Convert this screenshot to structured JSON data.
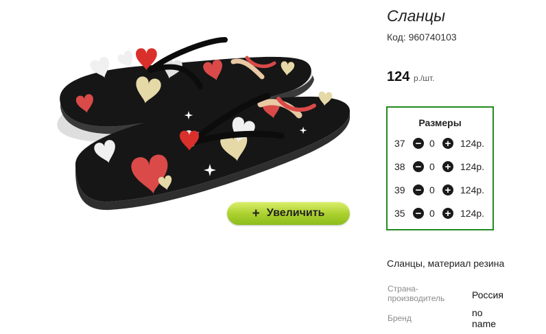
{
  "product": {
    "title": "Сланцы",
    "code_label": "Код:",
    "code_value": "960740103",
    "price_amount": "124",
    "price_unit": "р./шт.",
    "zoom_icon": "+",
    "zoom_label": "Увеличить",
    "image_icon": "flip-flops-product-photo",
    "description": "Сланцы, материал резина"
  },
  "sizes": {
    "title": "Размеры",
    "minus_icon": "−",
    "plus_icon": "+",
    "rows": [
      {
        "size": "37",
        "qty": "0",
        "price": "124р."
      },
      {
        "size": "38",
        "qty": "0",
        "price": "124р."
      },
      {
        "size": "39",
        "qty": "0",
        "price": "124р."
      },
      {
        "size": "35",
        "qty": "0",
        "price": "124р."
      }
    ]
  },
  "specs": [
    {
      "label_line1": "Страна-",
      "label_line2": "производитель",
      "value_line1": "Россия",
      "value_line2": ""
    },
    {
      "label_line1": "Бренд",
      "label_line2": "",
      "value_line1": "no",
      "value_line2": "name"
    }
  ],
  "colors": {
    "accent_border": "#1f8a1f",
    "button_green": "#a9cf2d",
    "sole_black": "#141414",
    "heart_red": "#c9302c"
  }
}
